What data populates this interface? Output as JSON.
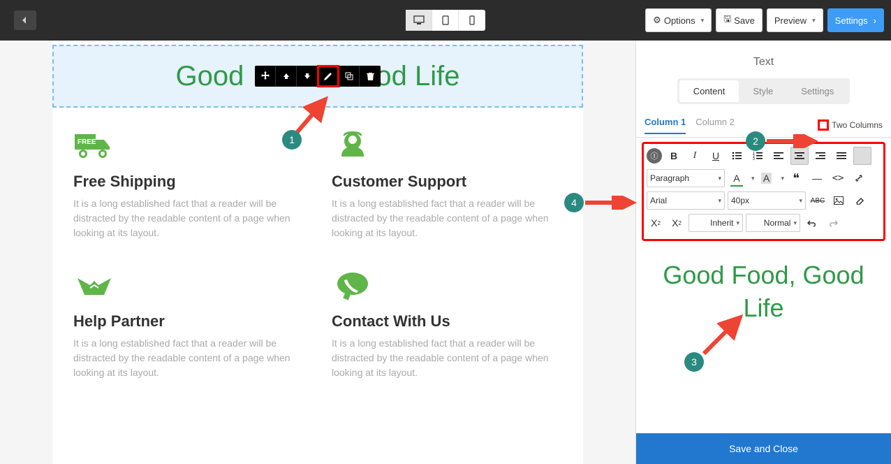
{
  "topbar": {
    "options_label": "Options",
    "save_label": "Save",
    "preview_label": "Preview",
    "settings_label": "Settings"
  },
  "canvas": {
    "selected_title": "Good Food, Good Life",
    "title_part1": "Good",
    "title_part2": "od Life",
    "features": [
      {
        "title": "Free Shipping",
        "desc": "It is a long established fact that a reader will be distracted by the readable content of a page when looking at its layout."
      },
      {
        "title": "Customer Support",
        "desc": "It is a long established fact that a reader will be distracted by the readable content of a page when looking at its layout."
      },
      {
        "title": "Help Partner",
        "desc": "It is a long established fact that a reader will be distracted by the readable content of a page when looking at its layout."
      },
      {
        "title": "Contact With Us",
        "desc": "It is a long established fact that a reader will be distracted by the readable content of a page when looking at its layout."
      }
    ]
  },
  "panel": {
    "title": "Text",
    "tabs": {
      "content": "Content",
      "style": "Style",
      "settings": "Settings"
    },
    "columns": {
      "col1": "Column 1",
      "col2": "Column 2",
      "two_cols": "Two Columns"
    },
    "rte": {
      "block": "Paragraph",
      "font": "Arial",
      "size": "40px",
      "inherit": "Inherit",
      "weight": "Normal"
    },
    "preview": "Good Food, Good Life",
    "save_close": "Save and Close"
  },
  "callouts": {
    "c1": "1",
    "c2": "2",
    "c3": "3",
    "c4": "4"
  }
}
